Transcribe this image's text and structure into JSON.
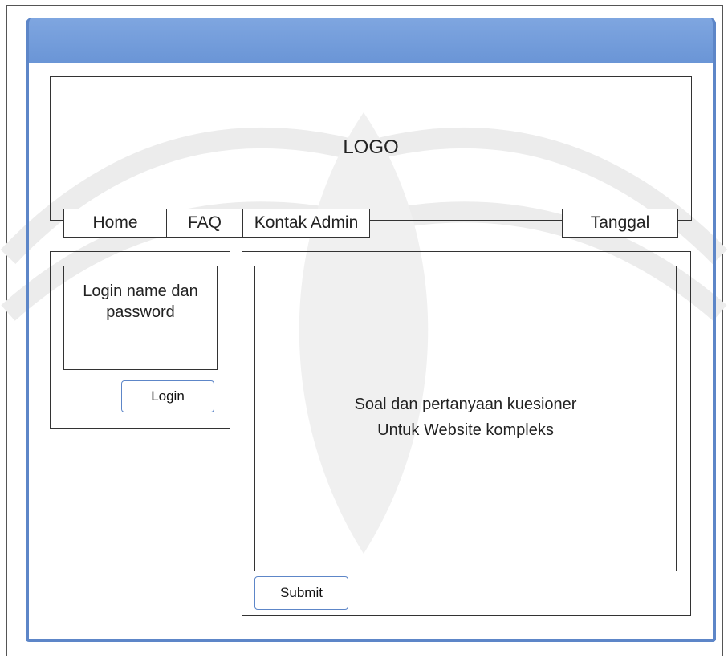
{
  "header": {
    "logo_text": "LOGO"
  },
  "nav": {
    "items": [
      {
        "label": "Home"
      },
      {
        "label": "FAQ"
      },
      {
        "label": "Kontak Admin"
      }
    ],
    "date_label": "Tanggal"
  },
  "login_panel": {
    "field_text_line1": "Login name dan",
    "field_text_line2": "password",
    "button_label": "Login"
  },
  "main": {
    "content_line1": "Soal dan pertanyaan kuesioner",
    "content_line2": "Untuk Website kompleks",
    "submit_label": "Submit"
  },
  "colors": {
    "window_accent": "#5d86c8",
    "title_bar": "#7fa6e0",
    "watermark": "#ebebeb"
  }
}
